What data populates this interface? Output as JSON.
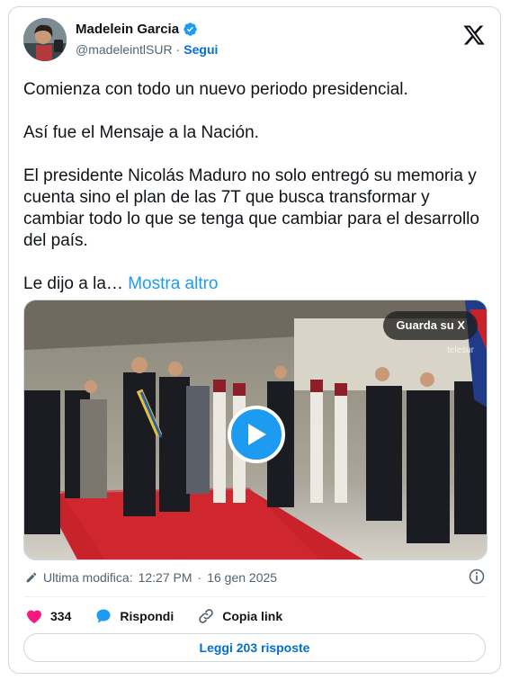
{
  "author": {
    "name": "Madelein Garcia",
    "handle": "@madeleintlSUR",
    "separator": "·",
    "follow_label": "Segui",
    "verified": true,
    "avatar_icon": "profile-photo"
  },
  "post": {
    "paragraphs": [
      "Comienza con todo un nuevo periodo presidencial.",
      "Así fue el Mensaje a la Nación.",
      "El presidente Nicolás Maduro no solo entregó su memoria y cuenta sino el plan de las 7T que busca transformar y cambiar todo lo que se tenga que cambiar para el desarrollo del país."
    ],
    "truncated_text": "Le dijo a la…",
    "show_more_label": "Mostra altro"
  },
  "media": {
    "watch_label": "Guarda su X",
    "watermark": "telesur",
    "play_icon": "play-icon"
  },
  "meta": {
    "edited_label": "Ultima modifica:",
    "time": "12:27 PM",
    "separator": "·",
    "date": "16 gen 2025"
  },
  "actions": {
    "like_count": "334",
    "reply_label": "Rispondi",
    "copy_link_label": "Copia link"
  },
  "read_replies_label": "Leggi 203 risposte",
  "colors": {
    "accent": "#1d9bf0",
    "link": "#006fd6",
    "like": "#f91880",
    "text": "#0f1419",
    "secondary": "#536471",
    "border": "#cfd9de"
  }
}
